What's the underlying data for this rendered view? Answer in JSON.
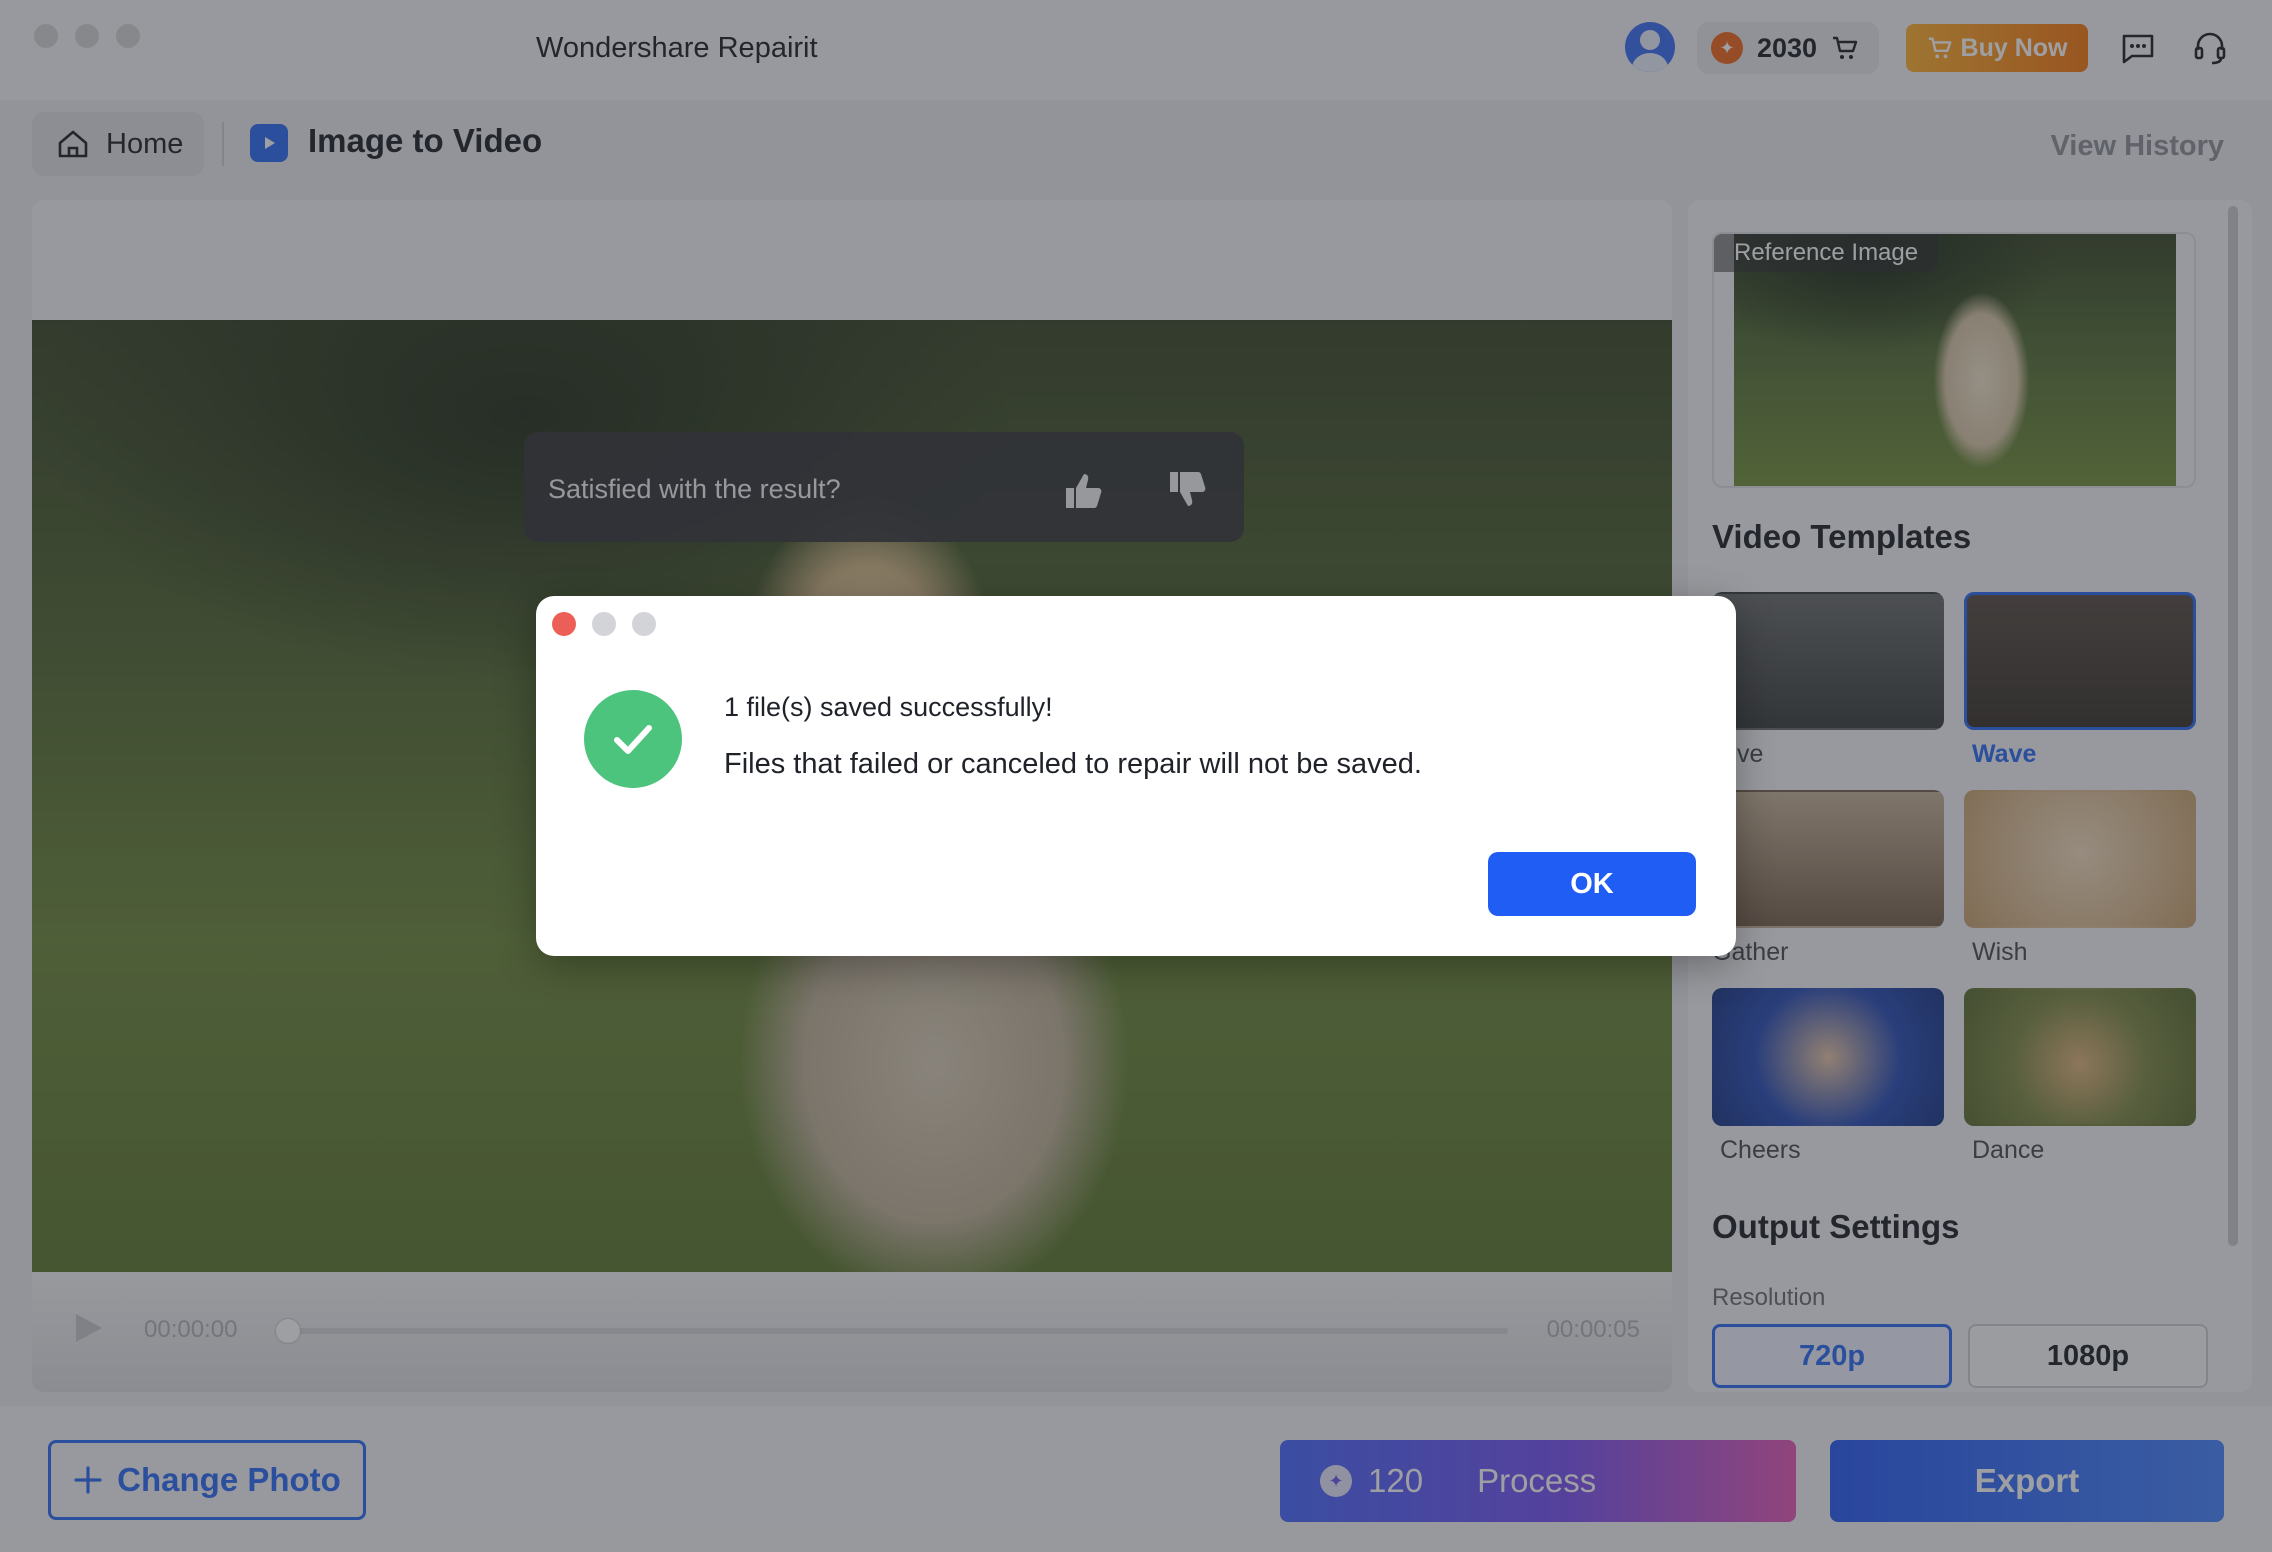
{
  "app": {
    "title": "Wondershare Repairit"
  },
  "header": {
    "credits": "2030",
    "buy_now_label": "Buy Now"
  },
  "breadcrumb": {
    "home_label": "Home",
    "page_title": "Image to Video",
    "view_history_label": "View History"
  },
  "preview": {
    "feedback_prompt": "Satisfied with the result?",
    "time_start": "00:00:00",
    "time_end": "00:00:05",
    "progress_fraction": 0
  },
  "sidebar": {
    "reference_label": "Reference Image",
    "templates_title": "Video Templates",
    "templates": [
      {
        "name": "elive",
        "selected": false
      },
      {
        "name": "Wave",
        "selected": true
      },
      {
        "name": "Gather",
        "selected": false
      },
      {
        "name": "Wish",
        "selected": false
      },
      {
        "name": "Cheers",
        "selected": false
      },
      {
        "name": "Dance",
        "selected": false
      }
    ],
    "output_title": "Output Settings",
    "resolution_label": "Resolution",
    "resolution_options": [
      "720p",
      "1080p"
    ],
    "resolution_selected": "720p"
  },
  "bottom": {
    "change_photo_label": "Change Photo",
    "process_cost": "120",
    "process_label": "Process",
    "export_label": "Export"
  },
  "dialog": {
    "message_primary": "1 file(s) saved successfully!",
    "message_secondary": "Files that failed or canceled to repair will not be saved.",
    "ok_label": "OK"
  },
  "colors": {
    "accent": "#2f6df6",
    "success": "#4cc47e",
    "buy_now": "#f57a14",
    "close_dot": "#ec5f57"
  }
}
